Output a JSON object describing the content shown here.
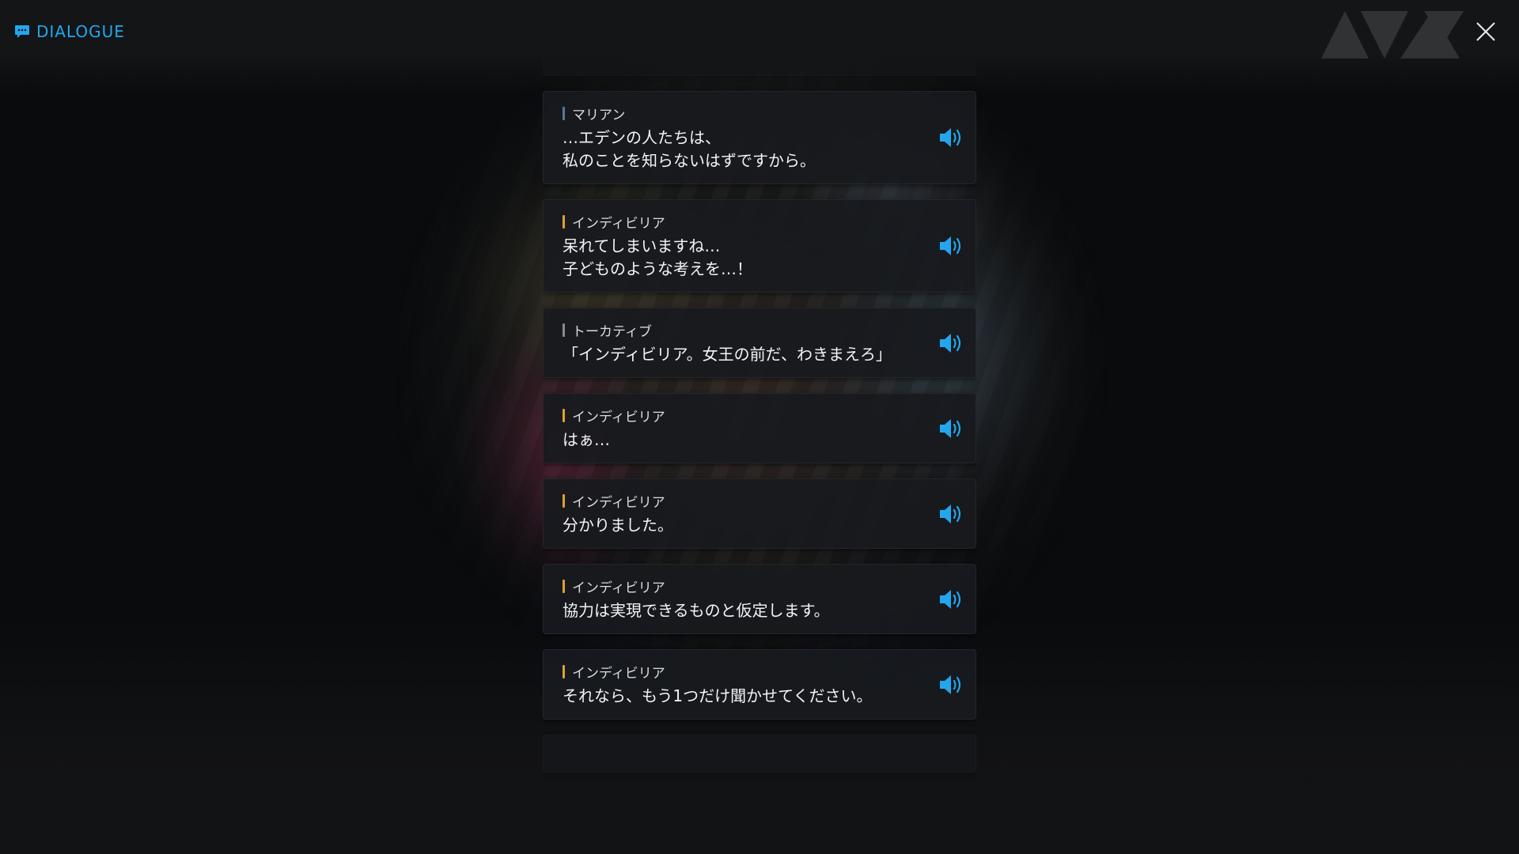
{
  "header": {
    "title": "DIALOGUE"
  },
  "colors": {
    "accent": "#22a7ee",
    "marian_bar": "#5a7a8e",
    "indiviria_bar": "#e0a030",
    "tokative_bar": "#8a8a8a"
  },
  "dialogue": [
    {
      "speaker": "マリアン",
      "text": "…エデンの人たちは、\n私のことを知らないはずですから。",
      "bar_color": "#5a7a8e"
    },
    {
      "speaker": "インディビリア",
      "text": "呆れてしまいますね…\n子どものような考えを…！",
      "bar_color": "#e0a030"
    },
    {
      "speaker": "トーカティブ",
      "text": "「インディビリア。女王の前だ、わきまえろ」",
      "bar_color": "#8a8a8a"
    },
    {
      "speaker": "インディビリア",
      "text": "はぁ…",
      "bar_color": "#e0a030"
    },
    {
      "speaker": "インディビリア",
      "text": "分かりました。",
      "bar_color": "#e0a030"
    },
    {
      "speaker": "インディビリア",
      "text": "協力は実現できるものと仮定します。",
      "bar_color": "#e0a030"
    },
    {
      "speaker": "インディビリア",
      "text": "それなら、もう1つだけ聞かせてください。",
      "bar_color": "#e0a030"
    }
  ],
  "icons": {
    "header": "chat-bubble-icon",
    "close": "close-icon",
    "voice": "speaker-volume-icon"
  }
}
